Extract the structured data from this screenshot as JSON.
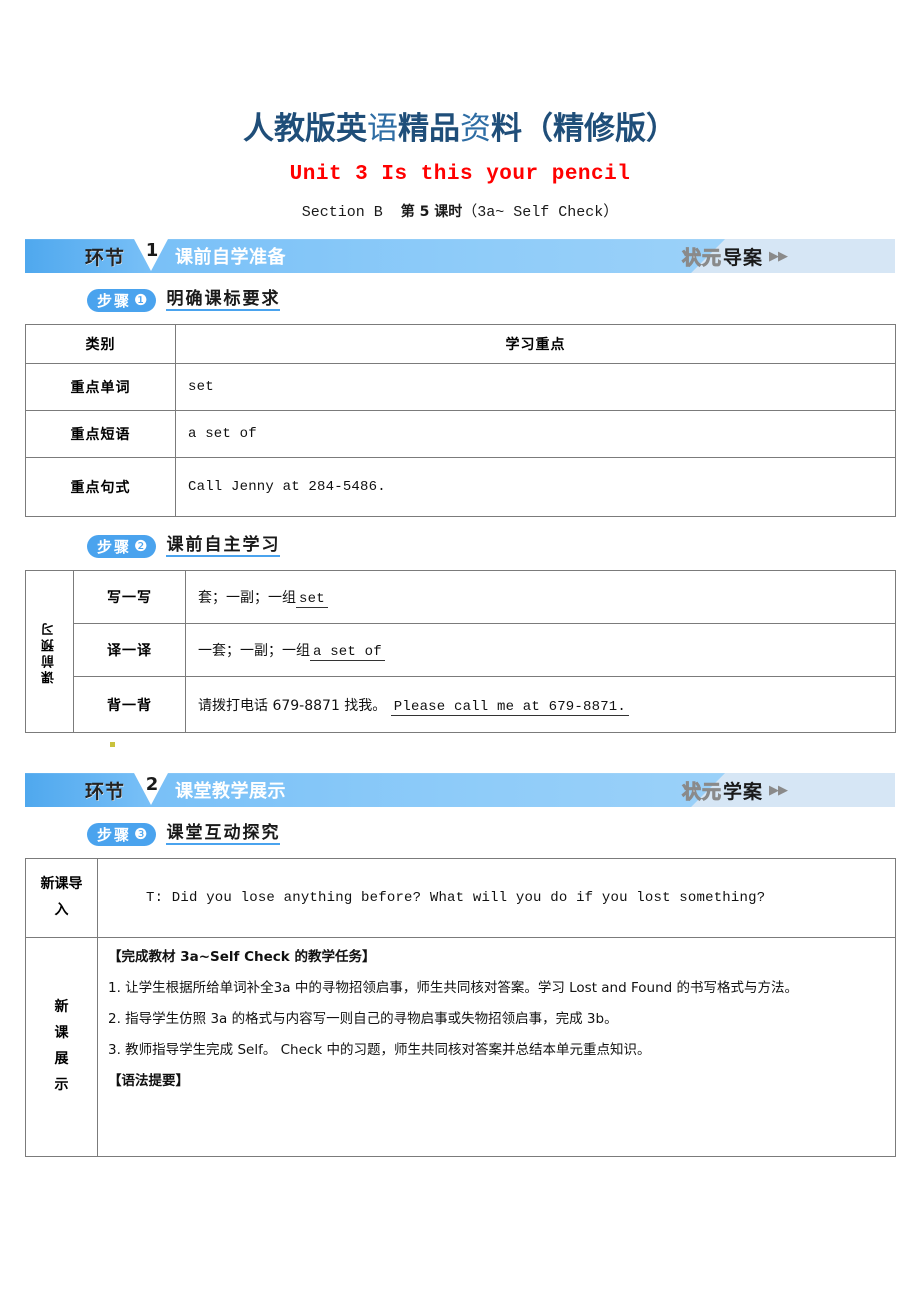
{
  "header": {
    "brand_prefix": "人教版英",
    "brand_thin": "语",
    "brand_mid": "精品",
    "brand_thin2": "资",
    "brand_suffix": "料（精修版）",
    "brand_full": "人教版英语精品资料（精修版）",
    "unit_title": "Unit 3 Is this your pencil",
    "section_en": "Section B",
    "section_cn": "第 5 课时",
    "section_paren": "（3a~ Self Check）"
  },
  "banner1": {
    "huanjie": "环节",
    "number": "1",
    "label": "课前自学准备",
    "badge_outline": "状元",
    "badge_solid": "导案",
    "arrows": "▶▶"
  },
  "banner2": {
    "huanjie": "环节",
    "number": "2",
    "label": "课堂教学展示",
    "badge_outline": "状元",
    "badge_solid": "学案",
    "arrows": "▶▶"
  },
  "step1": {
    "pill_text": "步骤",
    "pill_num": "❶",
    "title": "明确课标要求"
  },
  "step2": {
    "pill_text": "步骤",
    "pill_num": "❷",
    "title": "课前自主学习"
  },
  "step3": {
    "pill_text": "步骤",
    "pill_num": "❸",
    "title": "课堂互动探究"
  },
  "table1": {
    "headers": [
      "类别",
      "学习重点"
    ],
    "rows": [
      {
        "label": "重点单词",
        "value": "set"
      },
      {
        "label": "重点短语",
        "value": "a set of"
      },
      {
        "label": "重点句式",
        "value": "Call Jenny at 284-5486."
      }
    ]
  },
  "table2": {
    "side_label": "课前预习",
    "rows": [
      {
        "label": "写一写",
        "cn": "套；一副；一组",
        "blank": "set"
      },
      {
        "label": "译一译",
        "cn": "一套；一副；一组",
        "blank": "a set of"
      },
      {
        "label": "背一背",
        "cn": "请拨打电话 679-8871 找我。",
        "blank": "Please call me at 679-8871."
      }
    ]
  },
  "table3": {
    "intro_label": "新课导入",
    "intro_label_chars": [
      "新课导",
      "入"
    ],
    "intro_text": "T: Did you lose anything before? What will you do if you lost something?",
    "display_label": "新课展示",
    "display_label_chars": [
      "新",
      "课",
      "展",
      "示"
    ],
    "task_heading": "【完成教材 3a~Self Check 的教学任务】",
    "items": [
      "1. 让学生根据所给单词补全3a 中的寻物招领启事，师生共同核对答案。学习 Lost and Found 的书写格式与方法。",
      "2. 指导学生仿照 3a 的格式与内容写一则自己的寻物启事或失物招领启事，完成 3b。",
      "3. 教师指导学生完成 Self。 Check 中的习题，师生共同核对答案并总结本单元重点知识。"
    ],
    "grammar_heading": "【语法提要】"
  },
  "colors": {
    "banner_blue": "#7CC2F8",
    "banner_pale": "#D6E6F5",
    "pill_blue": "#4AA3EE",
    "title_red": "#FF0000",
    "brand_navy": "#1F4E79"
  }
}
